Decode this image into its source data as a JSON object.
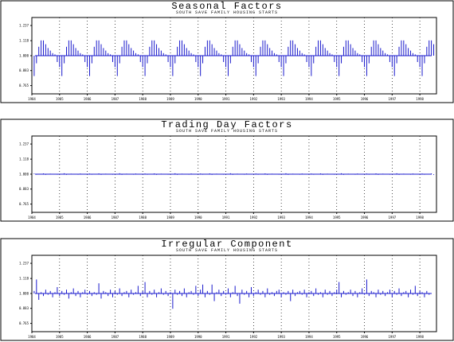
{
  "colors": {
    "bars": "#1a1acc",
    "frame": "#000000",
    "background": "#ffffff"
  },
  "chart_data": [
    {
      "type": "bar",
      "title": "Seasonal Factors",
      "subtitle": "SOUTH SAVE FAMILY HOUSING STARTS",
      "xlabel": "",
      "ylabel": "",
      "x_range": [
        1984,
        1998.6
      ],
      "ylim": [
        0.7,
        1.3
      ],
      "yticks": [
        "1.237",
        "1.118",
        "1.000",
        "0.883",
        "0.765"
      ],
      "ytick_values": [
        1.237,
        1.118,
        1.0,
        0.883,
        0.765
      ],
      "xticks": [
        "1984",
        "1985",
        "1986",
        "1987",
        "1988",
        "1989",
        "1990",
        "1991",
        "1992",
        "1993",
        "1994",
        "1995",
        "1996",
        "1997",
        "1998"
      ],
      "grid": "vertical dotted",
      "baseline": 1.0,
      "pattern": [
        0.84,
        0.94,
        1.07,
        1.12,
        1.12,
        1.09,
        1.06,
        1.04,
        1.02,
        1.01,
        0.95,
        0.91
      ],
      "start": 1984.0,
      "months": 174
    },
    {
      "type": "bar",
      "title": "Trading Day Factors",
      "subtitle": "SOUTH SAVE FAMILY HOUSING STARTS",
      "xlabel": "",
      "ylabel": "",
      "x_range": [
        1984,
        1998.6
      ],
      "ylim": [
        0.7,
        1.3
      ],
      "yticks": [
        "1.237",
        "1.118",
        "1.000",
        "0.883",
        "0.765"
      ],
      "ytick_values": [
        1.237,
        1.118,
        1.0,
        0.883,
        0.765
      ],
      "xticks": [
        "1984",
        "1985",
        "1986",
        "1987",
        "1988",
        "1989",
        "1990",
        "1991",
        "1992",
        "1993",
        "1994",
        "1995",
        "1996",
        "1997",
        "1998"
      ],
      "grid": "vertical dotted",
      "baseline": 1.0,
      "pattern": [
        1.005,
        0.996,
        1.003,
        0.998,
        1.006,
        0.995,
        1.002,
        1.004,
        0.997,
        1.003,
        0.996,
        1.001,
        0.999,
        1.007,
        0.995,
        1.002,
        1.004,
        0.997,
        1.001,
        0.996,
        1.005,
        0.998,
        1.003,
        0.997
      ],
      "start": 1984.0,
      "months": 174
    },
    {
      "type": "bar",
      "title": "Irregular Component",
      "subtitle": "SOUTH SAVE FAMILY HOUSING STARTS",
      "xlabel": "",
      "ylabel": "",
      "x_range": [
        1984,
        1998.6
      ],
      "ylim": [
        0.7,
        1.3
      ],
      "yticks": [
        "1.237",
        "1.118",
        "1.000",
        "0.883",
        "0.765"
      ],
      "ytick_values": [
        1.237,
        1.118,
        1.0,
        0.883,
        0.765
      ],
      "xticks": [
        "1984",
        "1985",
        "1986",
        "1987",
        "1988",
        "1989",
        "1990",
        "1991",
        "1992",
        "1993",
        "1994",
        "1995",
        "1996",
        "1997",
        "1998"
      ],
      "grid": "vertical dotted",
      "baseline": 1.0,
      "values": [
        1.02,
        1.11,
        0.95,
        1.01,
        0.98,
        1.03,
        0.99,
        1.02,
        0.97,
        1.01,
        1.05,
        0.98,
        1.02,
        0.99,
        1.03,
        0.96,
        1.01,
        1.04,
        0.98,
        1.02,
        0.97,
        1.01,
        1.03,
        0.99,
        1.02,
        0.98,
        1.01,
        0.99,
        1.08,
        0.96,
        1.02,
        1.01,
        0.98,
        1.03,
        0.97,
        1.02,
        0.99,
        1.04,
        0.98,
        1.01,
        1.02,
        0.97,
        1.03,
        0.99,
        1.01,
        1.06,
        0.98,
        1.02,
        1.09,
        0.97,
        1.02,
        0.99,
        1.03,
        0.97,
        1.01,
        1.04,
        0.99,
        1.02,
        0.98,
        1.01,
        0.88,
        1.03,
        0.99,
        1.02,
        0.98,
        1.04,
        0.97,
        1.01,
        1.02,
        0.99,
        1.06,
        0.98,
        1.03,
        1.07,
        0.97,
        1.02,
        0.99,
        1.07,
        0.94,
        1.01,
        1.03,
        0.98,
        1.02,
        0.99,
        1.04,
        0.97,
        1.01,
        1.06,
        0.98,
        0.92,
        1.03,
        0.99,
        1.02,
        0.97,
        1.05,
        0.98,
        1.01,
        1.03,
        0.99,
        1.02,
        0.97,
        1.04,
        0.99,
        1.01,
        0.98,
        1.02,
        1.03,
        0.97,
        1.01,
        0.99,
        1.02,
        0.94,
        1.03,
        0.98,
        1.01,
        1.02,
        0.99,
        1.03,
        0.97,
        1.01,
        1.02,
        0.98,
        1.04,
        0.99,
        1.01,
        0.97,
        1.03,
        0.99,
        1.02,
        0.98,
        1.01,
        1.03,
        1.09,
        0.97,
        1.02,
        0.99,
        1.01,
        1.03,
        0.98,
        1.02,
        0.97,
        1.01,
        1.04,
        0.99,
        1.11,
        0.98,
        1.02,
        1.01,
        0.97,
        1.03,
        0.99,
        1.02,
        0.98,
        1.01,
        1.03,
        0.97,
        1.02,
        0.99,
        1.04,
        0.98,
        1.01,
        1.02,
        0.97,
        1.03,
        0.99,
        1.06,
        0.98,
        1.02,
        1.01,
        0.97,
        1.02,
        0.99
      ],
      "start": 1984.0
    }
  ]
}
